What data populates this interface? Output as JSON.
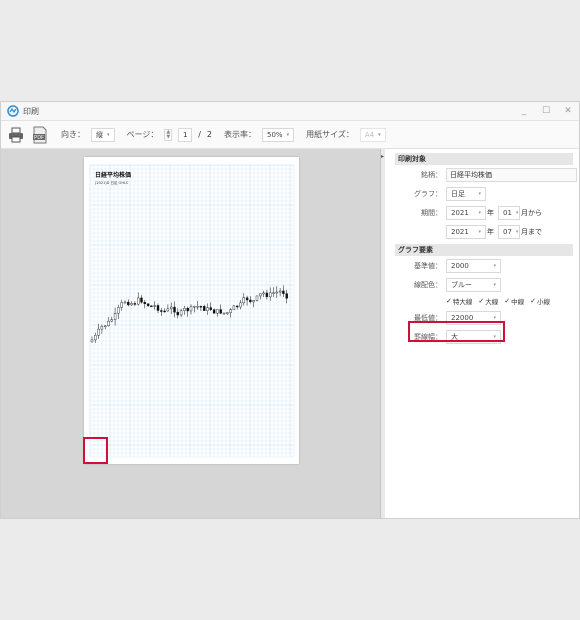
{
  "window": {
    "title": "印刷",
    "controls": {
      "minimize": "_",
      "maximize": "☐",
      "close": "✕"
    }
  },
  "toolbar": {
    "orientation_label": "向き：",
    "orientation_value": "縦",
    "page_label": "ページ：",
    "page_value": "1",
    "page_separator": "/",
    "page_total": "2",
    "zoom_label": "表示率：",
    "zoom_value": "50%",
    "paper_label": "用紙サイズ：",
    "paper_value": "A4"
  },
  "preview": {
    "doc_title": "日経平均株価",
    "doc_subtitle": "(2021)D 日足 OHLC"
  },
  "panel": {
    "print_target_header": "印刷対象",
    "symbol_label": "銘柄：",
    "symbol_value": "日経平均株価",
    "graph_label": "グラフ：",
    "graph_value": "日足",
    "period_label": "期間：",
    "from_year": "2021",
    "year_suffix": "年",
    "from_month": "01",
    "from_suffix": "月から",
    "to_year": "2021",
    "to_month": "07",
    "to_suffix": "月まで",
    "graph_elements_header": "グラフ要素",
    "base_label": "基準値：",
    "base_value": "2000",
    "color_label": "線配色：",
    "color_value": "ブルー",
    "checks": [
      "特大線",
      "大線",
      "中線",
      "小線"
    ],
    "min_label": "最低値：",
    "min_value": "22000",
    "width_label": "罫線幅：",
    "width_value": "大"
  },
  "colors": {
    "highlight": "#d0103a",
    "grid": "#cfe6f7",
    "grid_major": "#a9d0ee"
  }
}
